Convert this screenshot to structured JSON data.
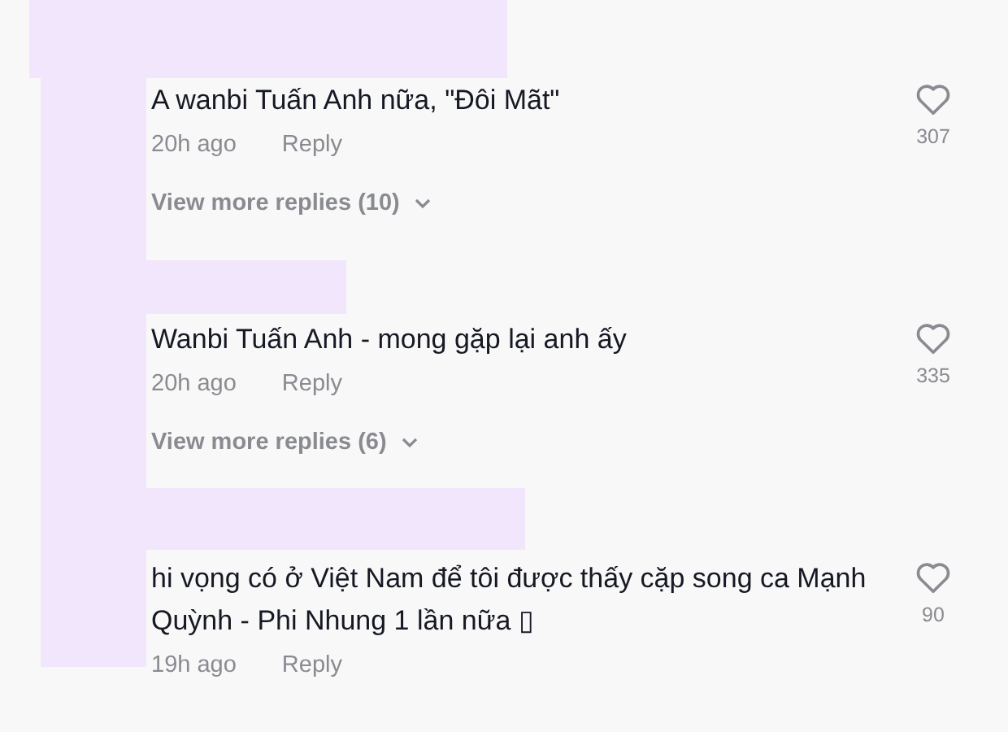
{
  "comments": [
    {
      "text": "A wanbi Tuấn Anh nữa, \"Đôi Mãt\"",
      "time": "20h ago",
      "reply": "Reply",
      "likes": "307",
      "liked": false,
      "view_more": "View more replies (10)"
    },
    {
      "text": "Wanbi Tuấn Anh - mong gặp lại anh ấy",
      "time": "20h ago",
      "reply": "Reply",
      "likes": "335",
      "liked": false,
      "view_more": "View more replies (6)"
    },
    {
      "text": "hi vọng có ở Việt Nam để tôi được thấy cặp song ca Mạnh Quỳnh - Phi Nhung 1 lần nữa ▯",
      "time": "19h ago",
      "reply": "Reply",
      "likes": "90",
      "liked": false
    }
  ]
}
